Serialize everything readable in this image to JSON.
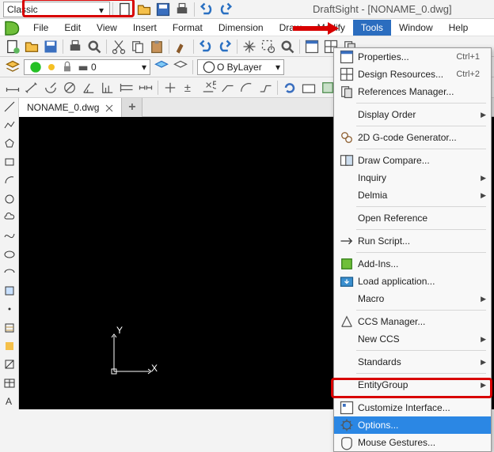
{
  "workspace": {
    "label": "Classic"
  },
  "app_title": "DraftSight - [NONAME_0.dwg]",
  "menu": [
    "File",
    "Edit",
    "View",
    "Insert",
    "Format",
    "Dimension",
    "Draw",
    "Modify",
    "Tools",
    "Window",
    "Help"
  ],
  "layer": {
    "status_icons": [
      "green",
      "sun",
      "lock",
      "print"
    ],
    "name": "0"
  },
  "color_combo": {
    "label": "O ByLayer"
  },
  "tab": {
    "name": "NONAME_0.dwg"
  },
  "ucs": {
    "xlabel": "X",
    "ylabel": "Y"
  },
  "tools_menu": {
    "g1": [
      {
        "icon": "props",
        "label": "Properties...",
        "shortcut": "Ctrl+1"
      },
      {
        "icon": "res",
        "label": "Design Resources...",
        "shortcut": "Ctrl+2"
      },
      {
        "icon": "ref",
        "label": "References Manager..."
      }
    ],
    "g2": [
      {
        "label": "Display Order",
        "sub": true
      }
    ],
    "g3": [
      {
        "icon": "gcode",
        "label": "2D G-code Generator..."
      }
    ],
    "g4": [
      {
        "icon": "dc",
        "label": "Draw Compare..."
      },
      {
        "label": "Inquiry",
        "sub": true
      },
      {
        "label": "Delmia",
        "sub": true
      }
    ],
    "g5": [
      {
        "label": "Open Reference"
      }
    ],
    "g6": [
      {
        "icon": "run",
        "label": "Run Script..."
      }
    ],
    "g7": [
      {
        "icon": "addin",
        "label": "Add-Ins..."
      },
      {
        "icon": "loadapp",
        "label": "Load application..."
      },
      {
        "label": "Macro",
        "sub": true
      }
    ],
    "g8": [
      {
        "icon": "ccs",
        "label": "CCS Manager..."
      },
      {
        "label": "New CCS",
        "sub": true
      }
    ],
    "g9": [
      {
        "label": "Standards",
        "sub": true
      }
    ],
    "g10": [
      {
        "label": "EntityGroup",
        "sub": true
      }
    ],
    "g11": [
      {
        "icon": "cust",
        "label": "Customize Interface..."
      },
      {
        "icon": "opt",
        "label": "Options...",
        "sel": true
      },
      {
        "icon": "mg",
        "label": "Mouse Gestures..."
      }
    ]
  }
}
